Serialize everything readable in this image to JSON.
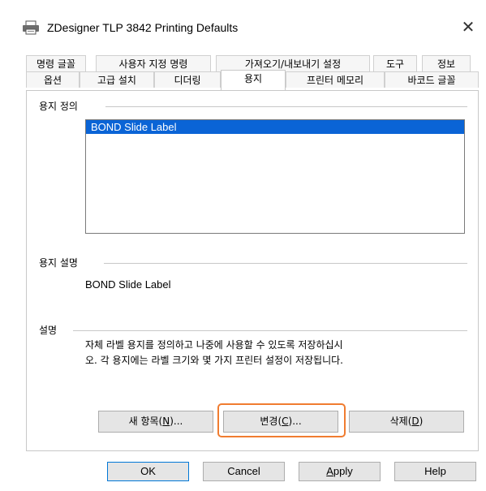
{
  "window": {
    "title": "ZDesigner TLP 3842 Printing Defaults",
    "close_glyph": "✕",
    "title_icon": "printer-icon"
  },
  "tabs_row1": [
    {
      "label": "명령 글꼴"
    },
    {
      "label": "사용자 지정 명령"
    },
    {
      "label": "가져오기/내보내기 설정"
    },
    {
      "label": "도구"
    },
    {
      "label": "정보"
    }
  ],
  "tabs_row2": [
    {
      "label": "옵션"
    },
    {
      "label": "고급 설치"
    },
    {
      "label": "디더링"
    },
    {
      "label": "용지",
      "active": true
    },
    {
      "label": "프린터 메모리"
    },
    {
      "label": "바코드 글꼴"
    }
  ],
  "paper_definition": {
    "label": "용지 정의",
    "items": [
      "BOND Slide Label"
    ]
  },
  "paper_description": {
    "label": "용지 설명",
    "value": "BOND Slide Label"
  },
  "description": {
    "label": "설명",
    "text_line1": "자체 라벨 용지를 정의하고 나중에 사용할 수 있도록 저장하십시",
    "text_line2": "오. 각 용지에는 라벨 크기와 몇 가지 프린터 설정이 저장됩니다."
  },
  "actions": {
    "new_prefix": "새 항목(",
    "new_key": "N",
    "new_suffix": ")...",
    "change_prefix": "변경(",
    "change_key": "C",
    "change_suffix": ")...",
    "delete_prefix": "삭제(",
    "delete_key": "D",
    "delete_suffix": ")"
  },
  "dialog_buttons": {
    "ok": "OK",
    "cancel": "Cancel",
    "apply_key": "A",
    "apply_rest": "pply",
    "help": "Help"
  },
  "colors": {
    "selection": "#0a64d6",
    "highlight_outline": "#f07c30"
  }
}
